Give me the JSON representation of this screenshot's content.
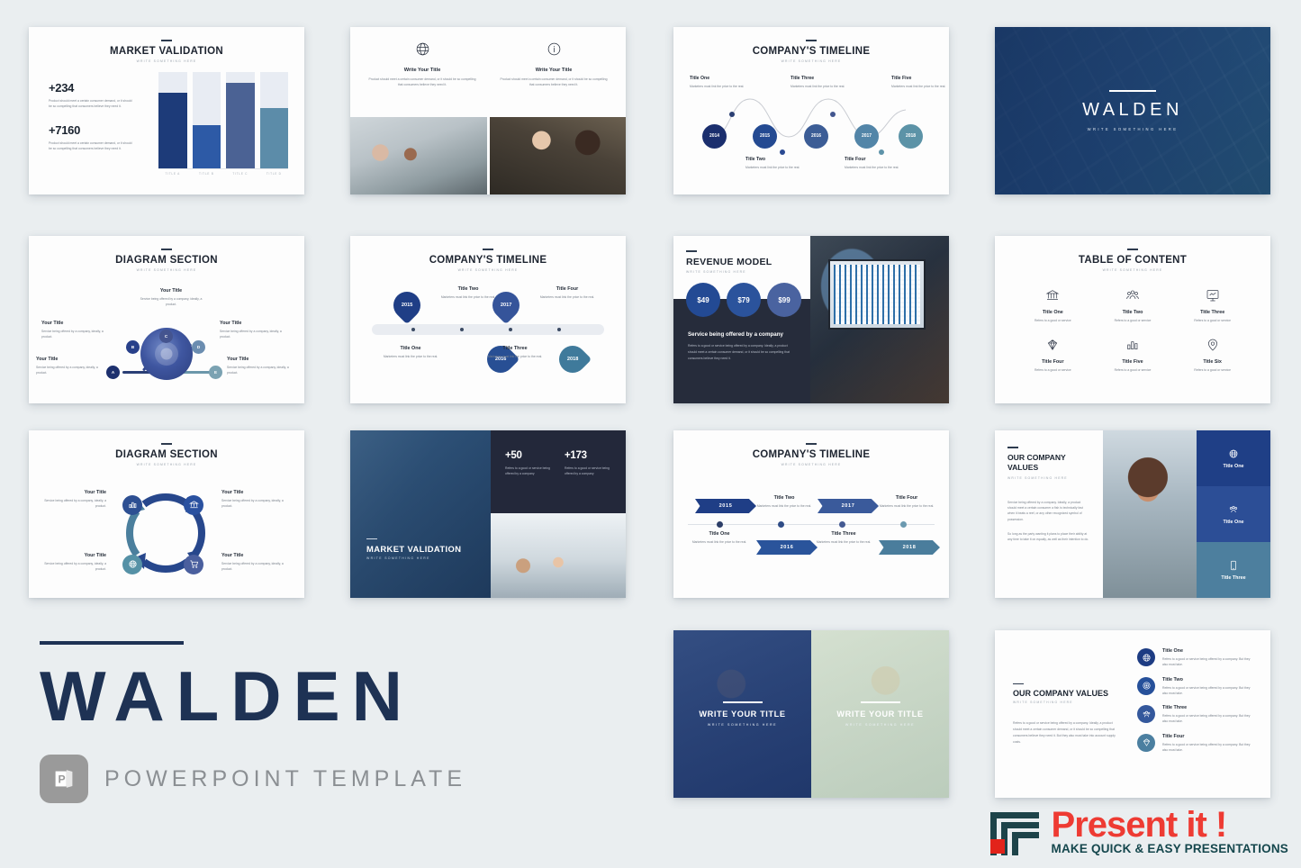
{
  "page": {
    "background": "#eaeef0"
  },
  "slides": [
    {
      "id": "market-validation",
      "title": "MARKET VALIDATION",
      "subtitle": "WRITE SOMETHING HERE",
      "stats": [
        {
          "value": "+234",
          "text": "Product should meet a certain consumer demand, or it should be so compelling that consumers believe they need it."
        },
        {
          "value": "+7160",
          "text": "Product should meet a certain consumer demand, or it should be so compelling that consumers believe they need it."
        }
      ],
      "chart_data": {
        "type": "bar",
        "title": "MARKET VALIDATION",
        "categories": [
          "TITLE A",
          "TITLE B",
          "TITLE C",
          "TITLE D"
        ],
        "values": [
          78,
          44,
          88,
          62
        ],
        "colors": [
          "#1d3b79",
          "#2d5aa6",
          "#4b6294",
          "#5c8ca9"
        ],
        "track_color": "#e8ecf3",
        "xlabel": "",
        "ylabel": "",
        "ylim": [
          0,
          100
        ],
        "grid": false,
        "legend": "none"
      }
    },
    {
      "id": "two-column-icons",
      "columns": [
        {
          "icon": "globe-icon",
          "title": "Write Your Title",
          "text": "Product should meet a certain consumer demand, or it should be so compelling that consumers believe they need it."
        },
        {
          "icon": "info-icon",
          "title": "Write Your Title",
          "text": "Product should meet a certain consumer demand, or it should be so compelling that consumers believe they need it."
        }
      ]
    },
    {
      "id": "company-timeline-wave",
      "title": "COMPANY'S TIMELINE",
      "subtitle": "WRITE SOMETHING HERE",
      "nodes": [
        {
          "year": "2014",
          "color": "#1b2f6e"
        },
        {
          "year": "2015",
          "color": "#244a92"
        },
        {
          "year": "2016",
          "color": "#3c5d96"
        },
        {
          "year": "2017",
          "color": "#5285a8"
        },
        {
          "year": "2018",
          "color": "#5c93a7"
        }
      ],
      "labels": [
        {
          "title": "Title One",
          "text": "Marketers must link the price to the real."
        },
        {
          "title": "Title Two",
          "text": "Marketers must link the price to the real."
        },
        {
          "title": "Title Three",
          "text": "Marketers must link the price to the real."
        },
        {
          "title": "Title Four",
          "text": "Marketers must link the price to the real."
        },
        {
          "title": "Title Five",
          "text": "Marketers must link the price to the real."
        }
      ]
    },
    {
      "id": "cover-walden",
      "title": "WALDEN",
      "subtitle": "WRITE SOMETHING HERE"
    },
    {
      "id": "diagram-section-radial",
      "title": "DIAGRAM SECTION",
      "subtitle": "WRITE SOMETHING HERE",
      "nodes": [
        "A",
        "B",
        "C",
        "D",
        "E"
      ],
      "labels": [
        {
          "title": "Your Title",
          "text": "Service being offered by a company, ideally, a product."
        },
        {
          "title": "Your Title",
          "text": "Service being offered by a company, ideally, a product."
        },
        {
          "title": "Your Title",
          "text": "Service being offered by a company, ideally, a product."
        },
        {
          "title": "Your Title",
          "text": "Service being offered by a company, ideally, a product."
        },
        {
          "title": "Your Title",
          "text": "Service being offered by a company, ideally, a product."
        }
      ]
    },
    {
      "id": "company-timeline-pins",
      "title": "COMPANY'S TIMELINE",
      "subtitle": "WRITE SOMETHING HERE",
      "pins": [
        {
          "year": "2015",
          "color": "#1f3e86"
        },
        {
          "year": "2016",
          "color": "#284f94"
        },
        {
          "year": "2017",
          "color": "#35549a"
        },
        {
          "year": "2018",
          "color": "#3f7a9b"
        }
      ],
      "labels": [
        {
          "title": "Title One",
          "text": "Marketers must link the price to the real."
        },
        {
          "title": "Title Two",
          "text": "Marketers must link the price to the real."
        },
        {
          "title": "Title Three",
          "text": "Marketers must link the price to the real."
        },
        {
          "title": "Title Four",
          "text": "Marketers must link the price to the real."
        }
      ]
    },
    {
      "id": "revenue-model",
      "title": "REVENUE MODEL",
      "subtitle": "WRITE SOMETHING HERE",
      "prices": [
        {
          "label": "$49",
          "color": "#234a94"
        },
        {
          "label": "$79",
          "color": "#2b539c"
        },
        {
          "label": "$99",
          "color": "#4a63a0"
        }
      ],
      "body_title": "Service being offered by a company",
      "body_text": "Refers to a good or service being offered by a company. Ideally, a product should meet a certain consumer demand, or it should be so compelling that consumers believe they need it."
    },
    {
      "id": "table-of-content",
      "title": "TABLE OF CONTENT",
      "subtitle": "WRITE SOMETHING HERE",
      "items": [
        {
          "icon": "bank-icon",
          "title": "Title One",
          "text": "Refers to a good or service"
        },
        {
          "icon": "people-icon",
          "title": "Title Two",
          "text": "Refers to a good or service"
        },
        {
          "icon": "presentation-icon",
          "title": "Title Three",
          "text": "Refers to a good or service"
        },
        {
          "icon": "diamond-icon",
          "title": "Title Four",
          "text": "Refers to a good or service"
        },
        {
          "icon": "bar-chart-icon",
          "title": "Title Five",
          "text": "Refers to a good or service"
        },
        {
          "icon": "location-pin-icon",
          "title": "Title Six",
          "text": "Refers to a good or service"
        }
      ]
    },
    {
      "id": "diagram-section-cycle",
      "title": "DIAGRAM SECTION",
      "subtitle": "WRITE SOMETHING HERE",
      "nodes": [
        {
          "icon": "bar-chart-icon",
          "color": "#2d4f92"
        },
        {
          "icon": "bank-icon",
          "color": "#2a51a0"
        },
        {
          "icon": "cart-icon",
          "color": "#4a5f9e"
        },
        {
          "icon": "globe-icon",
          "color": "#5591a6"
        }
      ],
      "labels": [
        {
          "title": "Your Title",
          "text": "Service being offered by a company, ideally, a product."
        },
        {
          "title": "Your Title",
          "text": "Service being offered by a company, ideally, a product."
        },
        {
          "title": "Your Title",
          "text": "Service being offered by a company, ideally, a product."
        },
        {
          "title": "Your Title",
          "text": "Service being offered by a company, ideally, a product."
        }
      ]
    },
    {
      "id": "market-validation-photo",
      "title": "MARKET VALIDATION",
      "subtitle": "WRITE SOMETHING HERE",
      "stats": [
        {
          "value": "+50",
          "text": "Refers to a good or service being offered by a company"
        },
        {
          "value": "+173",
          "text": "Refers to a good or service being offered by a company"
        }
      ]
    },
    {
      "id": "company-timeline-arrows",
      "title": "COMPANY'S TIMELINE",
      "subtitle": "WRITE SOMETHING HERE",
      "arrows": [
        {
          "year": "2015",
          "color": "#1f3e86"
        },
        {
          "year": "2016",
          "color": "#2a549b"
        },
        {
          "year": "2017",
          "color": "#3a5a9b"
        },
        {
          "year": "2018",
          "color": "#4a7d9c"
        }
      ],
      "labels": [
        {
          "title": "Title One",
          "text": "Marketers must link the price to the real."
        },
        {
          "title": "Title Two",
          "text": "Marketers must link the price to the real."
        },
        {
          "title": "Title Three",
          "text": "Marketers must link the price to the real."
        },
        {
          "title": "Title Four",
          "text": "Marketers must link the price to the real."
        }
      ]
    },
    {
      "id": "our-company-values-photo",
      "title": "OUR COMPANY VALUES",
      "subtitle": "WRITE SOMETHING HERE",
      "paragraph1": "Service being offered by a company. Ideally, a product should meet a certain consumer a fish is technically fast when it beats a reef, or any other recognized symbol of possession.",
      "paragraph2": "So long as the party wanting it plans to place their ability at any time to take it on equally, as well as their intention to do.",
      "tiles": [
        {
          "icon": "globe-icon",
          "label": "Title One",
          "color": "#1f3f86"
        },
        {
          "icon": "people-icon",
          "label": "Title One",
          "color": "#2c4e96"
        },
        {
          "icon": "phone-icon",
          "label": "Title Three",
          "color": "#4d7f9e"
        }
      ]
    },
    {
      "id": "dual-photo-titles",
      "panels": [
        {
          "title": "WRITE YOUR TITLE",
          "subtitle": "WRITE SOMETHING HERE"
        },
        {
          "title": "WRITE YOUR TITLE",
          "subtitle": "WRITE SOMETHING HERE"
        }
      ]
    },
    {
      "id": "our-company-values-list",
      "title": "OUR COMPANY VALUES",
      "subtitle": "WRITE SOMETHING HERE",
      "paragraph": "Refers to a good or service being offered by a company. Ideally, a product should meet a certain consumer demand, or it should be so compelling that consumers believe they need it. But they also must take into account supply costs.",
      "items": [
        {
          "icon": "globe-icon",
          "title": "Title One",
          "text": "Refers to a good or service being offered by a company. But they also must take.",
          "color": "#1d3c83"
        },
        {
          "icon": "target-icon",
          "title": "Title Two",
          "text": "Refers to a good or service being offered by a company. But they also must take.",
          "color": "#26509a"
        },
        {
          "icon": "people-icon",
          "title": "Title Three",
          "text": "Refers to a good or service being offered by a company. But they also must take.",
          "color": "#34589c"
        },
        {
          "icon": "diamond-icon",
          "title": "Title Four",
          "text": "Refers to a good or service being offered by a company. But they also must take.",
          "color": "#4b7fa0"
        }
      ]
    }
  ],
  "branding": {
    "title": "WALDEN",
    "subtitle": "POWERPOINT TEMPLATE",
    "badge_letter": "P",
    "accent": "#1e3254"
  },
  "publisher": {
    "name": "Present it !",
    "tagline": "MAKE QUICK & EASY PRESENTATIONS",
    "name_color": "#ee3b33",
    "tagline_color": "#15474d"
  }
}
